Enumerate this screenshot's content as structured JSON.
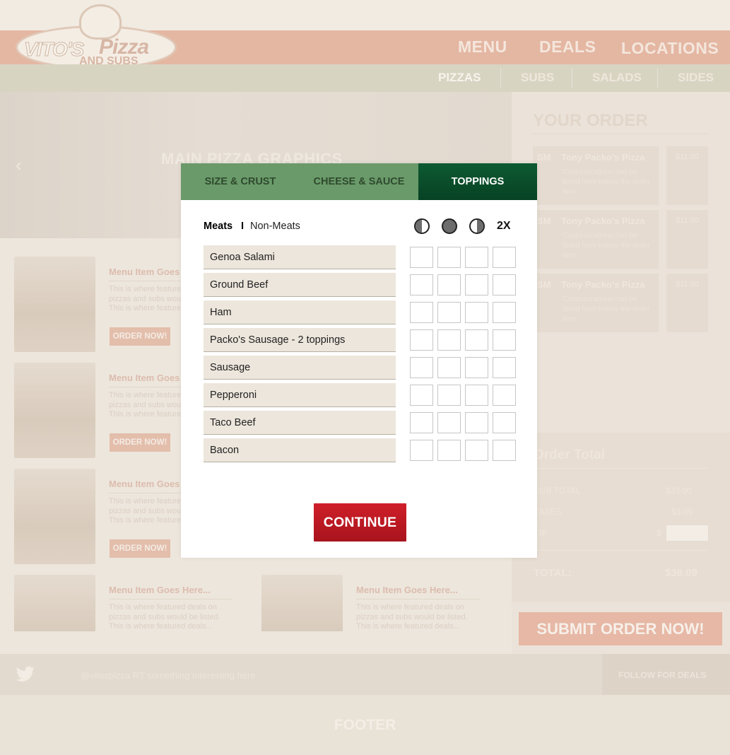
{
  "brand": {
    "word1": "VITO'S",
    "word2": "Pizza",
    "word3": "AND SUBS"
  },
  "nav": {
    "menu": "MENU",
    "deals": "DEALS",
    "locations": "LOCATIONS"
  },
  "subnav": {
    "pizzas": "PIZZAS",
    "subs": "SUBS",
    "salads": "SALADS",
    "sides": "SIDES"
  },
  "hero": {
    "title": "MAIN PIZZA GRAPHICS"
  },
  "menu_cards": [
    {
      "title": "Menu Item Goes Here...",
      "desc": "This is where featured deals on pizzas and subs would be listed. This is where featured deals...",
      "button": "ORDER NOW!"
    },
    {
      "title": "Menu Item Goes Here...",
      "desc": "This is where featured deals on pizzas and subs would be listed. This is where featured deals...",
      "button": "ORDER NOW!"
    },
    {
      "title": "Menu Item Goes Here...",
      "desc": "This is where featured deals on pizzas and subs would be listed. This is where featured deals...",
      "button": "ORDER NOW!"
    },
    {
      "title": "Menu Item Goes Here...",
      "desc": "This is where featured deals on pizzas and subs would be listed. This is where featured deals...",
      "button": "ORDER NOW!"
    },
    {
      "title": "Menu Item Goes Here...",
      "desc": "This is where featured deals on pizzas and subs would be listed. This is where featured deals...",
      "button": "ORDER NOW!"
    }
  ],
  "order": {
    "title": "YOUR ORDER",
    "items": [
      {
        "size": "SM",
        "name": "Tony Packo's Pizza",
        "note": "Customizations can be listed here below the order item",
        "price": "$11.00"
      },
      {
        "size": "SM",
        "name": "Tony Packo's Pizza",
        "note": "Customizations can be listed here below the order item",
        "price": "$11.00"
      },
      {
        "size": "SM",
        "name": "Tony Packo's Pizza",
        "note": "Customizations can be listed here below the order item",
        "price": "$11.00"
      }
    ],
    "total_title": "Order Total",
    "subtotal_label": "SUB TOTAL",
    "subtotal": "$33.00",
    "taxes_label": "TAXES",
    "taxes": "$3.09",
    "tip_label": "TIP",
    "tip_currency": "$",
    "total_label": "TOTAL:",
    "total": "$36.09",
    "submit": "SUBMIT ORDER NOW!"
  },
  "twitter": {
    "text": "@vitospizza RT something interesting here",
    "follow": "FOLLOW FOR DEALS"
  },
  "footer": {
    "text": "FOOTER"
  },
  "modal": {
    "tabs": [
      "SIZE & CRUST",
      "CHEESE & SAUCE",
      "TOPPINGS"
    ],
    "active_tab": "TOPPINGS",
    "categories": {
      "active": "Meats",
      "separator": "I",
      "other": "Non-Meats"
    },
    "portion_icons": [
      "left-half-icon",
      "whole-icon",
      "right-half-icon"
    ],
    "double_label": "2X",
    "toppings": [
      "Genoa Salami",
      "Ground Beef",
      "Ham",
      "Packo's Sausage - 2 toppings",
      "Sausage",
      "Pepperoni",
      "Taco Beef",
      "Bacon"
    ],
    "continue": "CONTINUE"
  },
  "colors": {
    "tab_bg": "#6a9a6a",
    "tab_active": "#0d5a32",
    "continue": "#c41a23",
    "row_bg": "#ede6dc"
  }
}
